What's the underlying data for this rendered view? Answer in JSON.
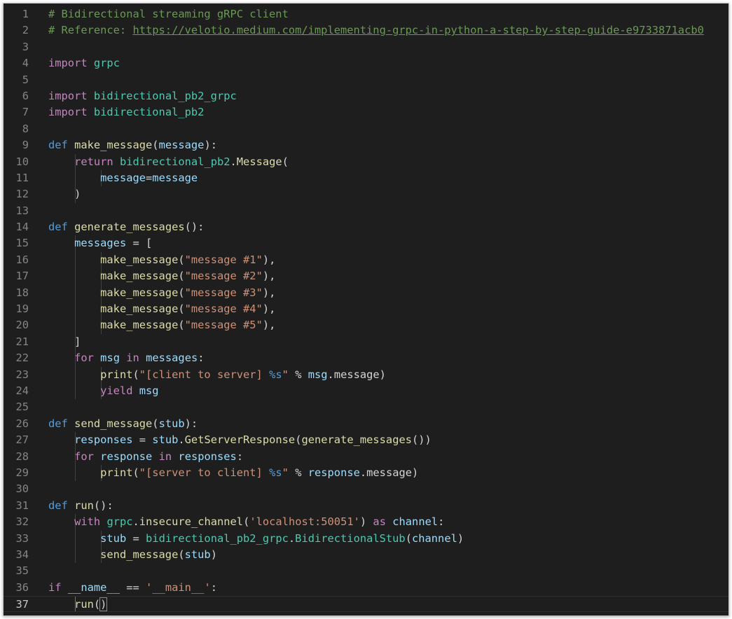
{
  "editor": {
    "current_line": 37,
    "lines": [
      {
        "n": "1",
        "tokens": [
          {
            "t": "# Bidirectional streaming gRPC client",
            "c": "cmt"
          }
        ]
      },
      {
        "n": "2",
        "tokens": [
          {
            "t": "# Reference: ",
            "c": "cmt"
          },
          {
            "t": "https://velotio.medium.com/implementing-grpc-in-python-a-step-by-step-guide-e9733871acb0",
            "c": "link"
          }
        ]
      },
      {
        "n": "3",
        "tokens": []
      },
      {
        "n": "4",
        "tokens": [
          {
            "t": "import",
            "c": "kw"
          },
          {
            "t": " ",
            "c": "op"
          },
          {
            "t": "grpc",
            "c": "mod"
          }
        ]
      },
      {
        "n": "5",
        "tokens": []
      },
      {
        "n": "6",
        "tokens": [
          {
            "t": "import",
            "c": "kw"
          },
          {
            "t": " ",
            "c": "op"
          },
          {
            "t": "bidirectional_pb2_grpc",
            "c": "mod"
          }
        ]
      },
      {
        "n": "7",
        "tokens": [
          {
            "t": "import",
            "c": "kw"
          },
          {
            "t": " ",
            "c": "op"
          },
          {
            "t": "bidirectional_pb2",
            "c": "mod"
          }
        ]
      },
      {
        "n": "8",
        "tokens": []
      },
      {
        "n": "9",
        "tokens": [
          {
            "t": "def",
            "c": "def"
          },
          {
            "t": " ",
            "c": "op"
          },
          {
            "t": "make_message",
            "c": "fn"
          },
          {
            "t": "(",
            "c": "op"
          },
          {
            "t": "message",
            "c": "var"
          },
          {
            "t": "):",
            "c": "op"
          }
        ]
      },
      {
        "n": "10",
        "guides": 1,
        "tokens": [
          {
            "t": "    ",
            "c": "op"
          },
          {
            "t": "return",
            "c": "kw"
          },
          {
            "t": " ",
            "c": "op"
          },
          {
            "t": "bidirectional_pb2",
            "c": "mod"
          },
          {
            "t": ".",
            "c": "op"
          },
          {
            "t": "Message",
            "c": "fn"
          },
          {
            "t": "(",
            "c": "op"
          }
        ]
      },
      {
        "n": "11",
        "guides": 2,
        "tokens": [
          {
            "t": "        ",
            "c": "op"
          },
          {
            "t": "message",
            "c": "var"
          },
          {
            "t": "=",
            "c": "op"
          },
          {
            "t": "message",
            "c": "var"
          }
        ]
      },
      {
        "n": "12",
        "guides": 1,
        "tokens": [
          {
            "t": "    )",
            "c": "op"
          }
        ]
      },
      {
        "n": "13",
        "tokens": []
      },
      {
        "n": "14",
        "tokens": [
          {
            "t": "def",
            "c": "def"
          },
          {
            "t": " ",
            "c": "op"
          },
          {
            "t": "generate_messages",
            "c": "fn"
          },
          {
            "t": "():",
            "c": "op"
          }
        ]
      },
      {
        "n": "15",
        "guides": 1,
        "tokens": [
          {
            "t": "    ",
            "c": "op"
          },
          {
            "t": "messages",
            "c": "var"
          },
          {
            "t": " = [",
            "c": "op"
          }
        ]
      },
      {
        "n": "16",
        "guides": 2,
        "tokens": [
          {
            "t": "        ",
            "c": "op"
          },
          {
            "t": "make_message",
            "c": "fn"
          },
          {
            "t": "(",
            "c": "op"
          },
          {
            "t": "\"message #1\"",
            "c": "str"
          },
          {
            "t": "),",
            "c": "op"
          }
        ]
      },
      {
        "n": "17",
        "guides": 2,
        "tokens": [
          {
            "t": "        ",
            "c": "op"
          },
          {
            "t": "make_message",
            "c": "fn"
          },
          {
            "t": "(",
            "c": "op"
          },
          {
            "t": "\"message #2\"",
            "c": "str"
          },
          {
            "t": "),",
            "c": "op"
          }
        ]
      },
      {
        "n": "18",
        "guides": 2,
        "tokens": [
          {
            "t": "        ",
            "c": "op"
          },
          {
            "t": "make_message",
            "c": "fn"
          },
          {
            "t": "(",
            "c": "op"
          },
          {
            "t": "\"message #3\"",
            "c": "str"
          },
          {
            "t": "),",
            "c": "op"
          }
        ]
      },
      {
        "n": "19",
        "guides": 2,
        "tokens": [
          {
            "t": "        ",
            "c": "op"
          },
          {
            "t": "make_message",
            "c": "fn"
          },
          {
            "t": "(",
            "c": "op"
          },
          {
            "t": "\"message #4\"",
            "c": "str"
          },
          {
            "t": "),",
            "c": "op"
          }
        ]
      },
      {
        "n": "20",
        "guides": 2,
        "tokens": [
          {
            "t": "        ",
            "c": "op"
          },
          {
            "t": "make_message",
            "c": "fn"
          },
          {
            "t": "(",
            "c": "op"
          },
          {
            "t": "\"message #5\"",
            "c": "str"
          },
          {
            "t": "),",
            "c": "op"
          }
        ]
      },
      {
        "n": "21",
        "guides": 1,
        "tokens": [
          {
            "t": "    ]",
            "c": "op"
          }
        ]
      },
      {
        "n": "22",
        "guides": 1,
        "tokens": [
          {
            "t": "    ",
            "c": "op"
          },
          {
            "t": "for",
            "c": "kw"
          },
          {
            "t": " ",
            "c": "op"
          },
          {
            "t": "msg",
            "c": "var"
          },
          {
            "t": " ",
            "c": "op"
          },
          {
            "t": "in",
            "c": "kw"
          },
          {
            "t": " ",
            "c": "op"
          },
          {
            "t": "messages",
            "c": "var"
          },
          {
            "t": ":",
            "c": "op"
          }
        ]
      },
      {
        "n": "23",
        "guides": 2,
        "tokens": [
          {
            "t": "        ",
            "c": "op"
          },
          {
            "t": "print",
            "c": "fn"
          },
          {
            "t": "(",
            "c": "op"
          },
          {
            "t": "\"[client to server] ",
            "c": "str"
          },
          {
            "t": "%s",
            "c": "fmt"
          },
          {
            "t": "\"",
            "c": "str"
          },
          {
            "t": " % ",
            "c": "op"
          },
          {
            "t": "msg",
            "c": "var"
          },
          {
            "t": ".message)",
            "c": "op"
          }
        ]
      },
      {
        "n": "24",
        "guides": 2,
        "tokens": [
          {
            "t": "        ",
            "c": "op"
          },
          {
            "t": "yield",
            "c": "kw"
          },
          {
            "t": " ",
            "c": "op"
          },
          {
            "t": "msg",
            "c": "var"
          }
        ]
      },
      {
        "n": "25",
        "tokens": []
      },
      {
        "n": "26",
        "tokens": [
          {
            "t": "def",
            "c": "def"
          },
          {
            "t": " ",
            "c": "op"
          },
          {
            "t": "send_message",
            "c": "fn"
          },
          {
            "t": "(",
            "c": "op"
          },
          {
            "t": "stub",
            "c": "var"
          },
          {
            "t": "):",
            "c": "op"
          }
        ]
      },
      {
        "n": "27",
        "guides": 1,
        "tokens": [
          {
            "t": "    ",
            "c": "op"
          },
          {
            "t": "responses",
            "c": "var"
          },
          {
            "t": " = ",
            "c": "op"
          },
          {
            "t": "stub",
            "c": "var"
          },
          {
            "t": ".",
            "c": "op"
          },
          {
            "t": "GetServerResponse",
            "c": "fn"
          },
          {
            "t": "(",
            "c": "op"
          },
          {
            "t": "generate_messages",
            "c": "fn"
          },
          {
            "t": "())",
            "c": "op"
          }
        ]
      },
      {
        "n": "28",
        "guides": 1,
        "tokens": [
          {
            "t": "    ",
            "c": "op"
          },
          {
            "t": "for",
            "c": "kw"
          },
          {
            "t": " ",
            "c": "op"
          },
          {
            "t": "response",
            "c": "var"
          },
          {
            "t": " ",
            "c": "op"
          },
          {
            "t": "in",
            "c": "kw"
          },
          {
            "t": " ",
            "c": "op"
          },
          {
            "t": "responses",
            "c": "var"
          },
          {
            "t": ":",
            "c": "op"
          }
        ]
      },
      {
        "n": "29",
        "guides": 2,
        "tokens": [
          {
            "t": "        ",
            "c": "op"
          },
          {
            "t": "print",
            "c": "fn"
          },
          {
            "t": "(",
            "c": "op"
          },
          {
            "t": "\"[server to client] ",
            "c": "str"
          },
          {
            "t": "%s",
            "c": "fmt"
          },
          {
            "t": "\"",
            "c": "str"
          },
          {
            "t": " % ",
            "c": "op"
          },
          {
            "t": "response",
            "c": "var"
          },
          {
            "t": ".message)",
            "c": "op"
          }
        ]
      },
      {
        "n": "30",
        "tokens": []
      },
      {
        "n": "31",
        "tokens": [
          {
            "t": "def",
            "c": "def"
          },
          {
            "t": " ",
            "c": "op"
          },
          {
            "t": "run",
            "c": "fn"
          },
          {
            "t": "():",
            "c": "op"
          }
        ]
      },
      {
        "n": "32",
        "guides": 1,
        "tokens": [
          {
            "t": "    ",
            "c": "op"
          },
          {
            "t": "with",
            "c": "kw"
          },
          {
            "t": " ",
            "c": "op"
          },
          {
            "t": "grpc",
            "c": "mod"
          },
          {
            "t": ".",
            "c": "op"
          },
          {
            "t": "insecure_channel",
            "c": "fn"
          },
          {
            "t": "(",
            "c": "op"
          },
          {
            "t": "'localhost:50051'",
            "c": "str"
          },
          {
            "t": ") ",
            "c": "op"
          },
          {
            "t": "as",
            "c": "kw"
          },
          {
            "t": " ",
            "c": "op"
          },
          {
            "t": "channel",
            "c": "var"
          },
          {
            "t": ":",
            "c": "op"
          }
        ]
      },
      {
        "n": "33",
        "guides": 2,
        "tokens": [
          {
            "t": "        ",
            "c": "op"
          },
          {
            "t": "stub",
            "c": "var"
          },
          {
            "t": " = ",
            "c": "op"
          },
          {
            "t": "bidirectional_pb2_grpc",
            "c": "mod"
          },
          {
            "t": ".",
            "c": "op"
          },
          {
            "t": "BidirectionalStub",
            "c": "mod"
          },
          {
            "t": "(",
            "c": "op"
          },
          {
            "t": "channel",
            "c": "var"
          },
          {
            "t": ")",
            "c": "op"
          }
        ]
      },
      {
        "n": "34",
        "guides": 2,
        "tokens": [
          {
            "t": "        ",
            "c": "op"
          },
          {
            "t": "send_message",
            "c": "fn"
          },
          {
            "t": "(",
            "c": "op"
          },
          {
            "t": "stub",
            "c": "var"
          },
          {
            "t": ")",
            "c": "op"
          }
        ]
      },
      {
        "n": "35",
        "tokens": []
      },
      {
        "n": "36",
        "tokens": [
          {
            "t": "if",
            "c": "kw"
          },
          {
            "t": " ",
            "c": "op"
          },
          {
            "t": "__name__",
            "c": "var"
          },
          {
            "t": " == ",
            "c": "op"
          },
          {
            "t": "'__main__'",
            "c": "str"
          },
          {
            "t": ":",
            "c": "op"
          }
        ]
      },
      {
        "n": "37",
        "guides": 1,
        "tokens": [
          {
            "t": "    ",
            "c": "op"
          },
          {
            "t": "run",
            "c": "fn"
          },
          {
            "t": "(",
            "c": "op"
          },
          {
            "t": ")",
            "c": "op bracket-match"
          }
        ]
      }
    ]
  }
}
